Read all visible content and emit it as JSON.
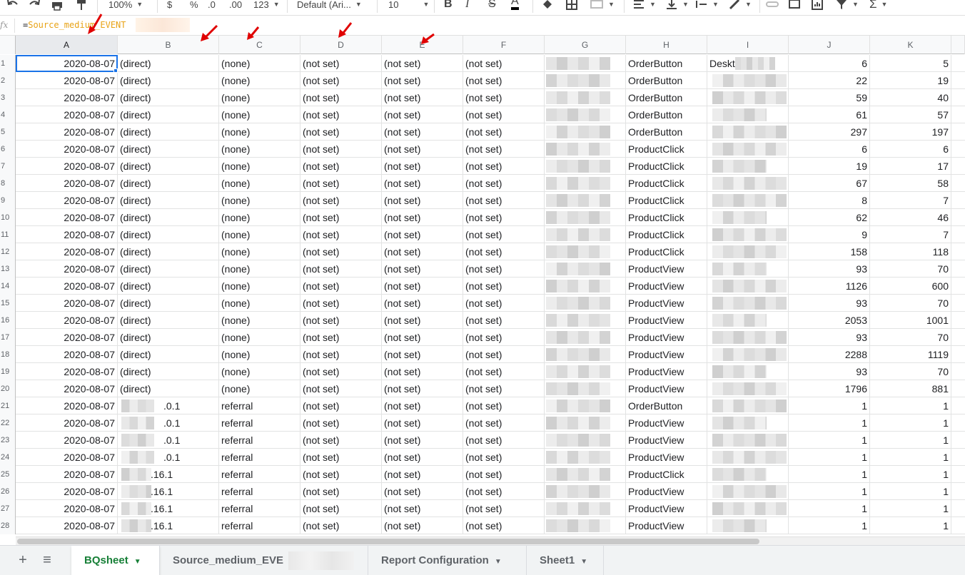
{
  "toolbar": {
    "zoom": "100%",
    "currency": "$",
    "percent": "%",
    "dec_decrease": ".0",
    "dec_increase": ".00",
    "more_formats": "123",
    "font": "Default (Ari...",
    "font_size": "10"
  },
  "formula_bar": {
    "fx_label": "fx",
    "equals": "=",
    "ref_text": "Source_medium_EVENT"
  },
  "columns": [
    "A",
    "B",
    "C",
    "D",
    "E",
    "F",
    "G",
    "H",
    "I",
    "J",
    "K"
  ],
  "rows": [
    {
      "num": "1",
      "a": "2020-08-07",
      "b": "(direct)",
      "c": "(none)",
      "d": "(not set)",
      "e": "(not set)",
      "f": "(not set)",
      "h": "OrderButton",
      "i": "Desktop D",
      "j": "6",
      "k": "5"
    },
    {
      "num": "2",
      "a": "2020-08-07",
      "b": "(direct)",
      "c": "(none)",
      "d": "(not set)",
      "e": "(not set)",
      "f": "(not set)",
      "h": "OrderButton",
      "i": "",
      "j": "22",
      "k": "19"
    },
    {
      "num": "3",
      "a": "2020-08-07",
      "b": "(direct)",
      "c": "(none)",
      "d": "(not set)",
      "e": "(not set)",
      "f": "(not set)",
      "h": "OrderButton",
      "i": "",
      "j": "59",
      "k": "40"
    },
    {
      "num": "4",
      "a": "2020-08-07",
      "b": "(direct)",
      "c": "(none)",
      "d": "(not set)",
      "e": "(not set)",
      "f": "(not set)",
      "h": "OrderButton",
      "i": "",
      "j": "61",
      "k": "57"
    },
    {
      "num": "5",
      "a": "2020-08-07",
      "b": "(direct)",
      "c": "(none)",
      "d": "(not set)",
      "e": "(not set)",
      "f": "(not set)",
      "h": "OrderButton",
      "i": "",
      "j": "297",
      "k": "197"
    },
    {
      "num": "6",
      "a": "2020-08-07",
      "b": "(direct)",
      "c": "(none)",
      "d": "(not set)",
      "e": "(not set)",
      "f": "(not set)",
      "h": "ProductClick",
      "i": "",
      "j": "6",
      "k": "6"
    },
    {
      "num": "7",
      "a": "2020-08-07",
      "b": "(direct)",
      "c": "(none)",
      "d": "(not set)",
      "e": "(not set)",
      "f": "(not set)",
      "h": "ProductClick",
      "i": "",
      "j": "19",
      "k": "17"
    },
    {
      "num": "8",
      "a": "2020-08-07",
      "b": "(direct)",
      "c": "(none)",
      "d": "(not set)",
      "e": "(not set)",
      "f": "(not set)",
      "h": "ProductClick",
      "i": "",
      "j": "67",
      "k": "58"
    },
    {
      "num": "9",
      "a": "2020-08-07",
      "b": "(direct)",
      "c": "(none)",
      "d": "(not set)",
      "e": "(not set)",
      "f": "(not set)",
      "h": "ProductClick",
      "i": "",
      "j": "8",
      "k": "7"
    },
    {
      "num": "10",
      "a": "2020-08-07",
      "b": "(direct)",
      "c": "(none)",
      "d": "(not set)",
      "e": "(not set)",
      "f": "(not set)",
      "h": "ProductClick",
      "i": "",
      "j": "62",
      "k": "46"
    },
    {
      "num": "11",
      "a": "2020-08-07",
      "b": "(direct)",
      "c": "(none)",
      "d": "(not set)",
      "e": "(not set)",
      "f": "(not set)",
      "h": "ProductClick",
      "i": "",
      "j": "9",
      "k": "7"
    },
    {
      "num": "12",
      "a": "2020-08-07",
      "b": "(direct)",
      "c": "(none)",
      "d": "(not set)",
      "e": "(not set)",
      "f": "(not set)",
      "h": "ProductClick",
      "i": "",
      "j": "158",
      "k": "118"
    },
    {
      "num": "13",
      "a": "2020-08-07",
      "b": "(direct)",
      "c": "(none)",
      "d": "(not set)",
      "e": "(not set)",
      "f": "(not set)",
      "h": "ProductView",
      "i": "",
      "j": "93",
      "k": "70"
    },
    {
      "num": "14",
      "a": "2020-08-07",
      "b": "(direct)",
      "c": "(none)",
      "d": "(not set)",
      "e": "(not set)",
      "f": "(not set)",
      "h": "ProductView",
      "i": "",
      "j": "1126",
      "k": "600"
    },
    {
      "num": "15",
      "a": "2020-08-07",
      "b": "(direct)",
      "c": "(none)",
      "d": "(not set)",
      "e": "(not set)",
      "f": "(not set)",
      "h": "ProductView",
      "i": "",
      "j": "93",
      "k": "70"
    },
    {
      "num": "16",
      "a": "2020-08-07",
      "b": "(direct)",
      "c": "(none)",
      "d": "(not set)",
      "e": "(not set)",
      "f": "(not set)",
      "h": "ProductView",
      "i": "",
      "j": "2053",
      "k": "1001"
    },
    {
      "num": "17",
      "a": "2020-08-07",
      "b": "(direct)",
      "c": "(none)",
      "d": "(not set)",
      "e": "(not set)",
      "f": "(not set)",
      "h": "ProductView",
      "i": "",
      "j": "93",
      "k": "70"
    },
    {
      "num": "18",
      "a": "2020-08-07",
      "b": "(direct)",
      "c": "(none)",
      "d": "(not set)",
      "e": "(not set)",
      "f": "(not set)",
      "h": "ProductView",
      "i": "",
      "j": "2288",
      "k": "1119"
    },
    {
      "num": "19",
      "a": "2020-08-07",
      "b": "(direct)",
      "c": "(none)",
      "d": "(not set)",
      "e": "(not set)",
      "f": "(not set)",
      "h": "ProductView",
      "i": "",
      "j": "93",
      "k": "70"
    },
    {
      "num": "20",
      "a": "2020-08-07",
      "b": "(direct)",
      "c": "(none)",
      "d": "(not set)",
      "e": "(not set)",
      "f": "(not set)",
      "h": "ProductView",
      "i": "",
      "j": "1796",
      "k": "881"
    },
    {
      "num": "21",
      "a": "2020-08-07",
      "b": ".0.1",
      "c": "referral",
      "d": "(not set)",
      "e": "(not set)",
      "f": "(not set)",
      "h": "OrderButton",
      "i": "",
      "j": "1",
      "k": "1"
    },
    {
      "num": "22",
      "a": "2020-08-07",
      "b": ".0.1",
      "c": "referral",
      "d": "(not set)",
      "e": "(not set)",
      "f": "(not set)",
      "h": "ProductView",
      "i": "",
      "j": "1",
      "k": "1"
    },
    {
      "num": "23",
      "a": "2020-08-07",
      "b": ".0.1",
      "c": "referral",
      "d": "(not set)",
      "e": "(not set)",
      "f": "(not set)",
      "h": "ProductView",
      "i": "",
      "j": "1",
      "k": "1"
    },
    {
      "num": "24",
      "a": "2020-08-07",
      "b": ".0.1",
      "c": "referral",
      "d": "(not set)",
      "e": "(not set)",
      "f": "(not set)",
      "h": "ProductView",
      "i": "",
      "j": "1",
      "k": "1"
    },
    {
      "num": "25",
      "a": "2020-08-07",
      "b": ".16.1",
      "c": "referral",
      "d": "(not set)",
      "e": "(not set)",
      "f": "(not set)",
      "h": "ProductClick",
      "i": "",
      "j": "1",
      "k": "1"
    },
    {
      "num": "26",
      "a": "2020-08-07",
      "b": ".16.1",
      "c": "referral",
      "d": "(not set)",
      "e": "(not set)",
      "f": "(not set)",
      "h": "ProductView",
      "i": "",
      "j": "1",
      "k": "1"
    },
    {
      "num": "27",
      "a": "2020-08-07",
      "b": ".16.1",
      "c": "referral",
      "d": "(not set)",
      "e": "(not set)",
      "f": "(not set)",
      "h": "ProductView",
      "i": "",
      "j": "1",
      "k": "1"
    },
    {
      "num": "28",
      "a": "2020-08-07",
      "b": ".16.1",
      "c": "referral",
      "d": "(not set)",
      "e": "(not set)",
      "f": "(not set)",
      "h": "ProductView",
      "i": "",
      "j": "1",
      "k": "1"
    }
  ],
  "sheet_tabs": {
    "add_icon": "+",
    "list_icon": "≡",
    "tabs": [
      {
        "label": "BQsheet"
      },
      {
        "label": "Source_medium_EVE"
      },
      {
        "label": "Report Configuration"
      },
      {
        "label": "Sheet1"
      }
    ]
  },
  "colors": {
    "selection": "#1a73e8",
    "active_tab": "#188038",
    "annotation_arrow": "#e00000",
    "formula_ref": "#e8a317"
  }
}
